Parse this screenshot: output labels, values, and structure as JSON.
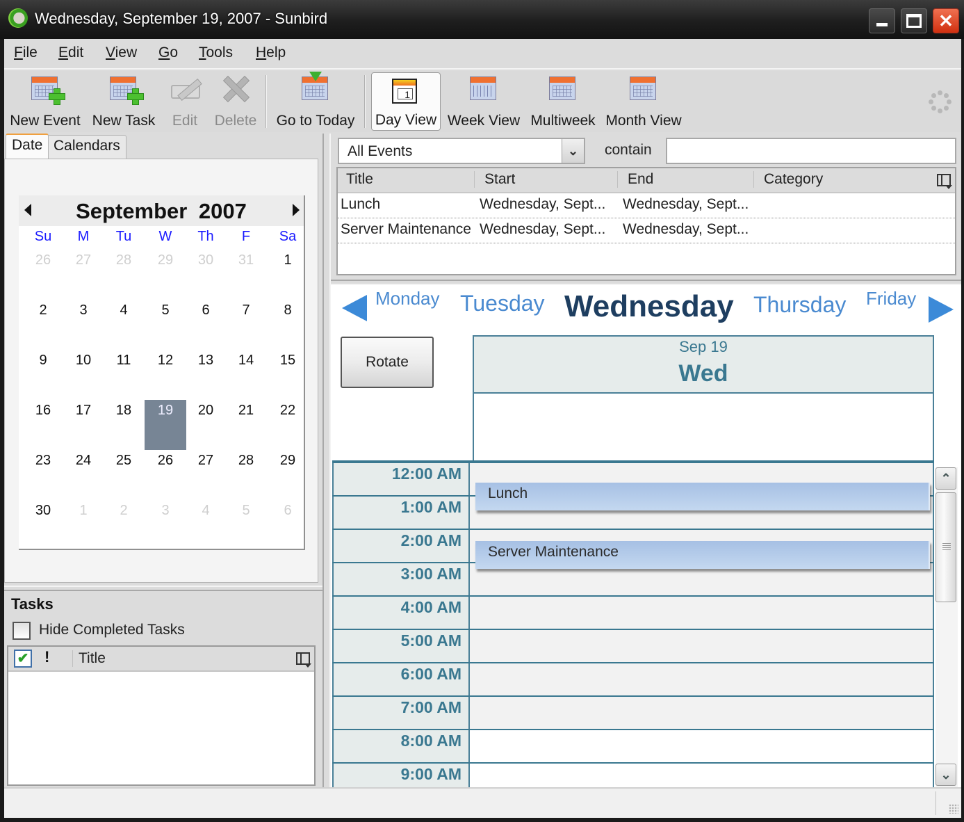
{
  "window": {
    "title": "Wednesday, September 19, 2007 - Sunbird",
    "app_icon": "sunbird-logo-icon",
    "controls": {
      "minimize": "minimize-icon",
      "maximize": "maximize-icon",
      "close": "close-icon",
      "close_glyph": "✕"
    }
  },
  "menu": [
    "File",
    "Edit",
    "View",
    "Go",
    "Tools",
    "Help"
  ],
  "toolbar": {
    "new_event": "New Event",
    "new_task": "New Task",
    "edit": "Edit",
    "delete": "Delete",
    "go_to_today": "Go to Today",
    "day_view": "Day View",
    "day_view_icon_number": "1",
    "week_view": "Week View",
    "multiweek": "Multiweek",
    "month_view": "Month View",
    "active_view": "Day View"
  },
  "sidebar": {
    "tabs": [
      "Date",
      "Calendars"
    ],
    "active_tab": "Date",
    "minical": {
      "title": "September  2007",
      "weekdays": [
        "Su",
        "M",
        "Tu",
        "W",
        "Th",
        "F",
        "Sa"
      ],
      "weeks": [
        [
          {
            "d": "26",
            "o": true
          },
          {
            "d": "27",
            "o": true
          },
          {
            "d": "28",
            "o": true
          },
          {
            "d": "29",
            "o": true
          },
          {
            "d": "30",
            "o": true
          },
          {
            "d": "31",
            "o": true
          },
          {
            "d": "1"
          }
        ],
        [
          {
            "d": "2"
          },
          {
            "d": "3"
          },
          {
            "d": "4"
          },
          {
            "d": "5"
          },
          {
            "d": "6"
          },
          {
            "d": "7"
          },
          {
            "d": "8"
          }
        ],
        [
          {
            "d": "9"
          },
          {
            "d": "10"
          },
          {
            "d": "11"
          },
          {
            "d": "12"
          },
          {
            "d": "13"
          },
          {
            "d": "14"
          },
          {
            "d": "15"
          }
        ],
        [
          {
            "d": "16"
          },
          {
            "d": "17"
          },
          {
            "d": "18"
          },
          {
            "d": "19",
            "sel": true
          },
          {
            "d": "20"
          },
          {
            "d": "21"
          },
          {
            "d": "22"
          }
        ],
        [
          {
            "d": "23"
          },
          {
            "d": "24"
          },
          {
            "d": "25"
          },
          {
            "d": "26"
          },
          {
            "d": "27"
          },
          {
            "d": "28"
          },
          {
            "d": "29"
          }
        ],
        [
          {
            "d": "30"
          },
          {
            "d": "1",
            "o": true
          },
          {
            "d": "2",
            "o": true
          },
          {
            "d": "3",
            "o": true
          },
          {
            "d": "4",
            "o": true
          },
          {
            "d": "5",
            "o": true
          },
          {
            "d": "6",
            "o": true
          }
        ]
      ],
      "selected_day": "19"
    },
    "tasks": {
      "title": "Tasks",
      "hide_completed_label": "Hide Completed Tasks",
      "hide_completed_checked": false,
      "columns": {
        "done": "✔",
        "priority": "!",
        "title": "Title"
      },
      "items": []
    }
  },
  "events_list": {
    "filter": "All Events",
    "filter_dropdown_glyph": "⌄",
    "contain_label": "contain",
    "search_value": "",
    "columns": [
      "Title",
      "Start",
      "End",
      "Category"
    ],
    "rows": [
      {
        "title": "Lunch",
        "start": "Wednesday, Sept...",
        "end": "Wednesday, Sept...",
        "category": ""
      },
      {
        "title": "Server Maintenance",
        "start": "Wednesday, Sept...",
        "end": "Wednesday, Sept...",
        "category": ""
      }
    ]
  },
  "day_view": {
    "nav_days": [
      "Monday",
      "Tuesday",
      "Wednesday",
      "Thursday",
      "Friday"
    ],
    "current_day": "Wednesday",
    "rotate_label": "Rotate",
    "header_date": "Sep 19",
    "header_dow": "Wed",
    "hours": [
      "12:00 AM",
      "1:00 AM",
      "2:00 AM",
      "3:00 AM",
      "4:00 AM",
      "5:00 AM",
      "6:00 AM",
      "7:00 AM",
      "8:00 AM",
      "9:00 AM"
    ],
    "work_hours_start_index": 8,
    "events": [
      {
        "title": "Lunch",
        "start_hour": 0.5
      },
      {
        "title": "Server Maintenance",
        "start_hour": 2.25
      }
    ],
    "scroll": {
      "up_glyph": "⌃",
      "down_glyph": "⌄"
    }
  },
  "colors": {
    "accent_teal": "#3a7890",
    "selected_day": "#778595",
    "event_fill": "#b4cdea",
    "nav_blue": "#4a8ad0",
    "weekday_blue": "#1a1aff"
  }
}
